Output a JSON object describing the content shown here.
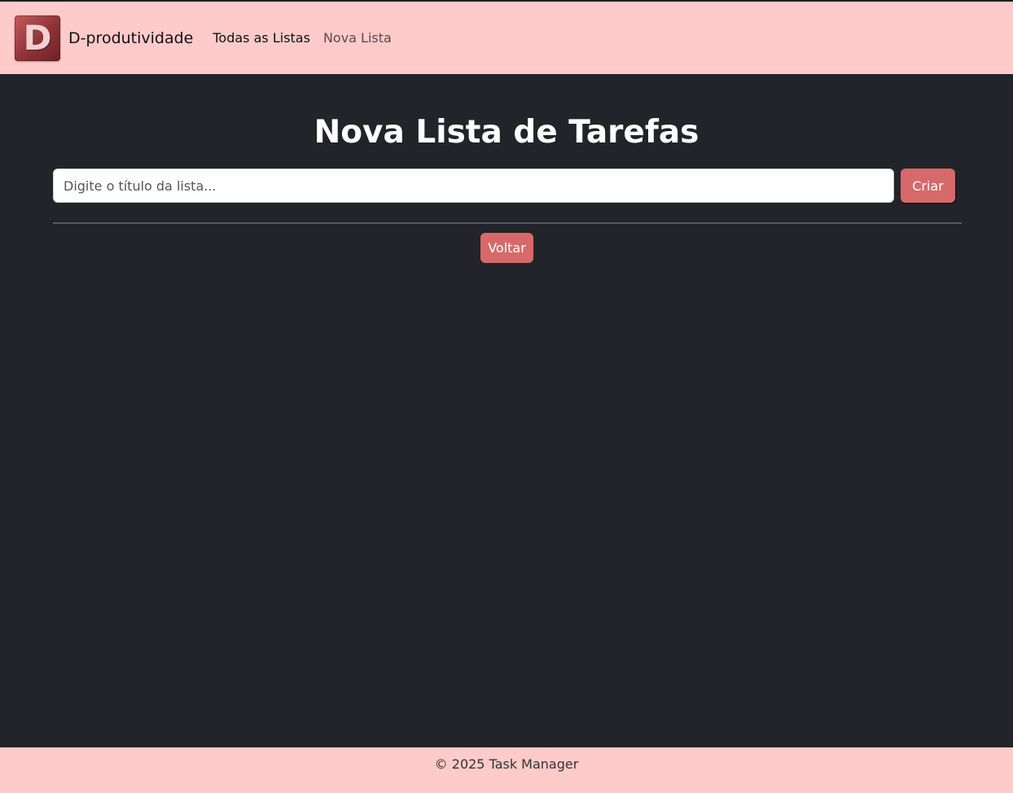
{
  "navbar": {
    "logo_letter": "D",
    "brand": "D-produtividade",
    "links": [
      {
        "label": "Todas as Listas",
        "active": true
      },
      {
        "label": "Nova Lista",
        "active": false
      }
    ]
  },
  "main": {
    "title": "Nova Lista de Tarefas",
    "input": {
      "placeholder": "Digite o título da lista...",
      "value": ""
    },
    "create_label": "Criar",
    "back_label": "Voltar"
  },
  "footer": {
    "text": "© 2025 Task Manager"
  },
  "colors": {
    "navbar_bg": "#ffcaca",
    "page_bg": "#222429",
    "button_bg": "#d66a6a",
    "logo_bg": "#8d3337"
  }
}
